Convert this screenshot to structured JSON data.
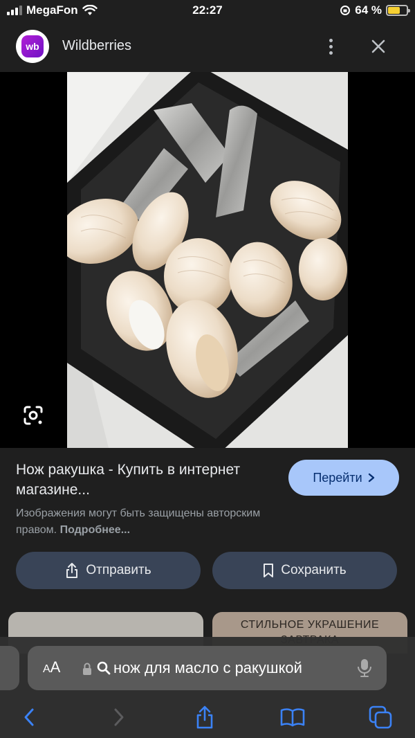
{
  "status_bar": {
    "carrier": "MegaFon",
    "time": "22:27",
    "battery_text": "64 %",
    "battery_level": 0.64
  },
  "header": {
    "site_name": "Wildberries",
    "logo_text": "wb"
  },
  "result": {
    "title": "Нож ракушка - Купить в интернет магазине...",
    "goto_label": "Перейти",
    "copyright_text": "Изображения могут быть защищены авторским правом.",
    "more_label": "Подробнее..."
  },
  "actions": {
    "share_label": "Отправить",
    "save_label": "Сохранить"
  },
  "related": {
    "thumb2_text": "СТИЛЬНОЕ УКРАШЕНИЕ ЗАВТРАКА"
  },
  "browser": {
    "aa_label_small": "A",
    "aa_label_large": "A",
    "query": "нож для масло с ракушкой"
  },
  "colors": {
    "accent": "#a8c7fa",
    "button_bg": "#394457",
    "battery": "#f6d033",
    "icon_blue": "#3b82f6"
  }
}
